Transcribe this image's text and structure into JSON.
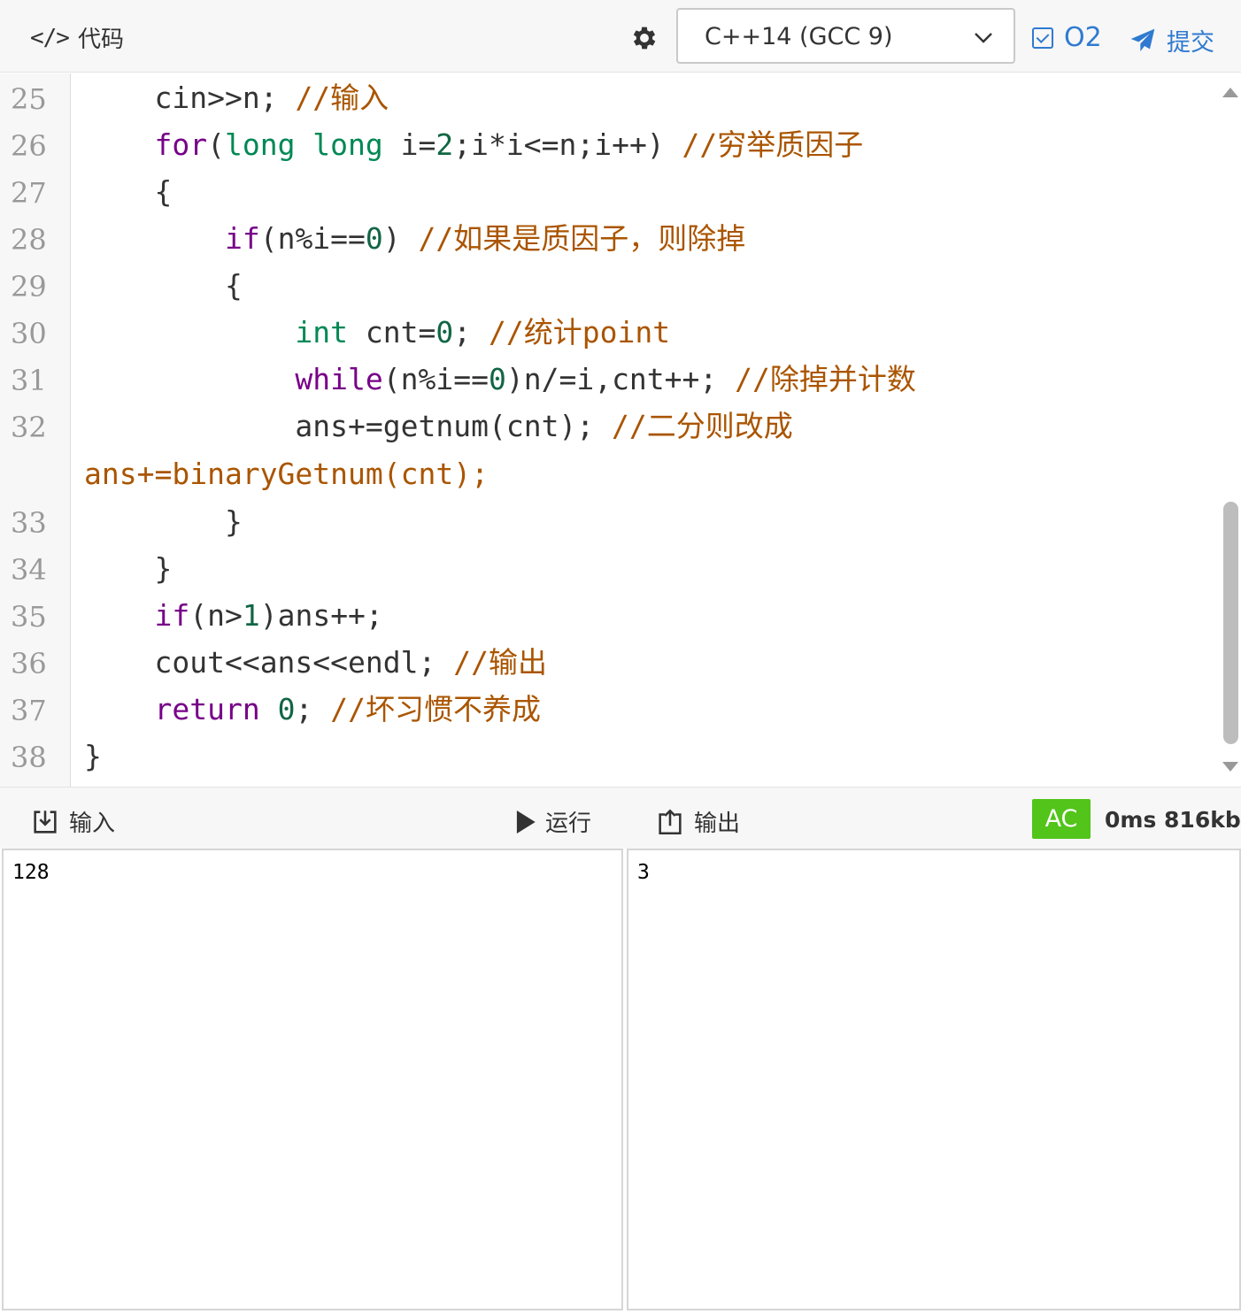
{
  "toolbar": {
    "code_icon": "</>",
    "code_label": "代码",
    "language_selected": "C++14 (GCC 9)",
    "o2_label": "O2",
    "o2_checked": true,
    "submit_label": "提交"
  },
  "editor": {
    "line_numbers": [
      "25",
      "26",
      "27",
      "28",
      "29",
      "30",
      "31",
      "32",
      "33",
      "34",
      "35",
      "36",
      "37",
      "38"
    ],
    "lines": [
      {
        "indent": "    ",
        "parts": [
          {
            "t": "cin>>n; ",
            "c": ""
          },
          {
            "t": "//输入",
            "c": "cm"
          }
        ]
      },
      {
        "indent": "    ",
        "parts": [
          {
            "t": "for",
            "c": "kw"
          },
          {
            "t": "(",
            "c": ""
          },
          {
            "t": "long long",
            "c": "ty"
          },
          {
            "t": " i=",
            "c": ""
          },
          {
            "t": "2",
            "c": "nm"
          },
          {
            "t": ";i*i<=n;i++) ",
            "c": ""
          },
          {
            "t": "//穷举质因子",
            "c": "cm"
          }
        ]
      },
      {
        "indent": "    ",
        "parts": [
          {
            "t": "{",
            "c": ""
          }
        ]
      },
      {
        "indent": "        ",
        "parts": [
          {
            "t": "if",
            "c": "kw"
          },
          {
            "t": "(n%i==",
            "c": ""
          },
          {
            "t": "0",
            "c": "nm"
          },
          {
            "t": ") ",
            "c": ""
          },
          {
            "t": "//如果是质因子，则除掉",
            "c": "cm"
          }
        ]
      },
      {
        "indent": "        ",
        "parts": [
          {
            "t": "{",
            "c": ""
          }
        ]
      },
      {
        "indent": "            ",
        "parts": [
          {
            "t": "int",
            "c": "ty"
          },
          {
            "t": " cnt=",
            "c": ""
          },
          {
            "t": "0",
            "c": "nm"
          },
          {
            "t": "; ",
            "c": ""
          },
          {
            "t": "//统计point",
            "c": "cm"
          }
        ]
      },
      {
        "indent": "            ",
        "parts": [
          {
            "t": "while",
            "c": "kw"
          },
          {
            "t": "(n%i==",
            "c": ""
          },
          {
            "t": "0",
            "c": "nm"
          },
          {
            "t": ")n/=i,cnt++; ",
            "c": ""
          },
          {
            "t": "//除掉并计数",
            "c": "cm"
          }
        ]
      },
      {
        "indent": "            ",
        "parts": [
          {
            "t": "ans+=getnum(cnt); ",
            "c": ""
          },
          {
            "t": "//二分则改成",
            "c": "cm"
          }
        ]
      },
      {
        "indent": "",
        "parts": [
          {
            "t": "ans+=binaryGetnum(cnt);",
            "c": "cm"
          }
        ]
      },
      {
        "indent": "        ",
        "parts": [
          {
            "t": "}",
            "c": ""
          }
        ]
      },
      {
        "indent": "    ",
        "parts": [
          {
            "t": "}",
            "c": ""
          }
        ]
      },
      {
        "indent": "    ",
        "parts": [
          {
            "t": "if",
            "c": "kw"
          },
          {
            "t": "(n>",
            "c": ""
          },
          {
            "t": "1",
            "c": "nm"
          },
          {
            "t": ")ans++;",
            "c": ""
          }
        ]
      },
      {
        "indent": "    ",
        "parts": [
          {
            "t": "cout<<ans<<endl; ",
            "c": ""
          },
          {
            "t": "//输出",
            "c": "cm"
          }
        ]
      },
      {
        "indent": "    ",
        "parts": [
          {
            "t": "return",
            "c": "kw"
          },
          {
            "t": " ",
            "c": ""
          },
          {
            "t": "0",
            "c": "nm"
          },
          {
            "t": "; ",
            "c": ""
          },
          {
            "t": "//坏习惯不养成",
            "c": "cm"
          }
        ]
      },
      {
        "indent": "",
        "parts": [
          {
            "t": "}",
            "c": ""
          }
        ]
      }
    ]
  },
  "iobar": {
    "input_label": "输入",
    "run_label": "运行",
    "output_label": "输出",
    "status": "AC",
    "perf": "0ms 816kb"
  },
  "input_value": "128",
  "output_value": "3",
  "colors": {
    "keyword": "#770088",
    "type": "#008855",
    "number": "#116644",
    "comment": "#aa5500",
    "accent": "#2f7ad0",
    "ac": "#52c41a"
  }
}
